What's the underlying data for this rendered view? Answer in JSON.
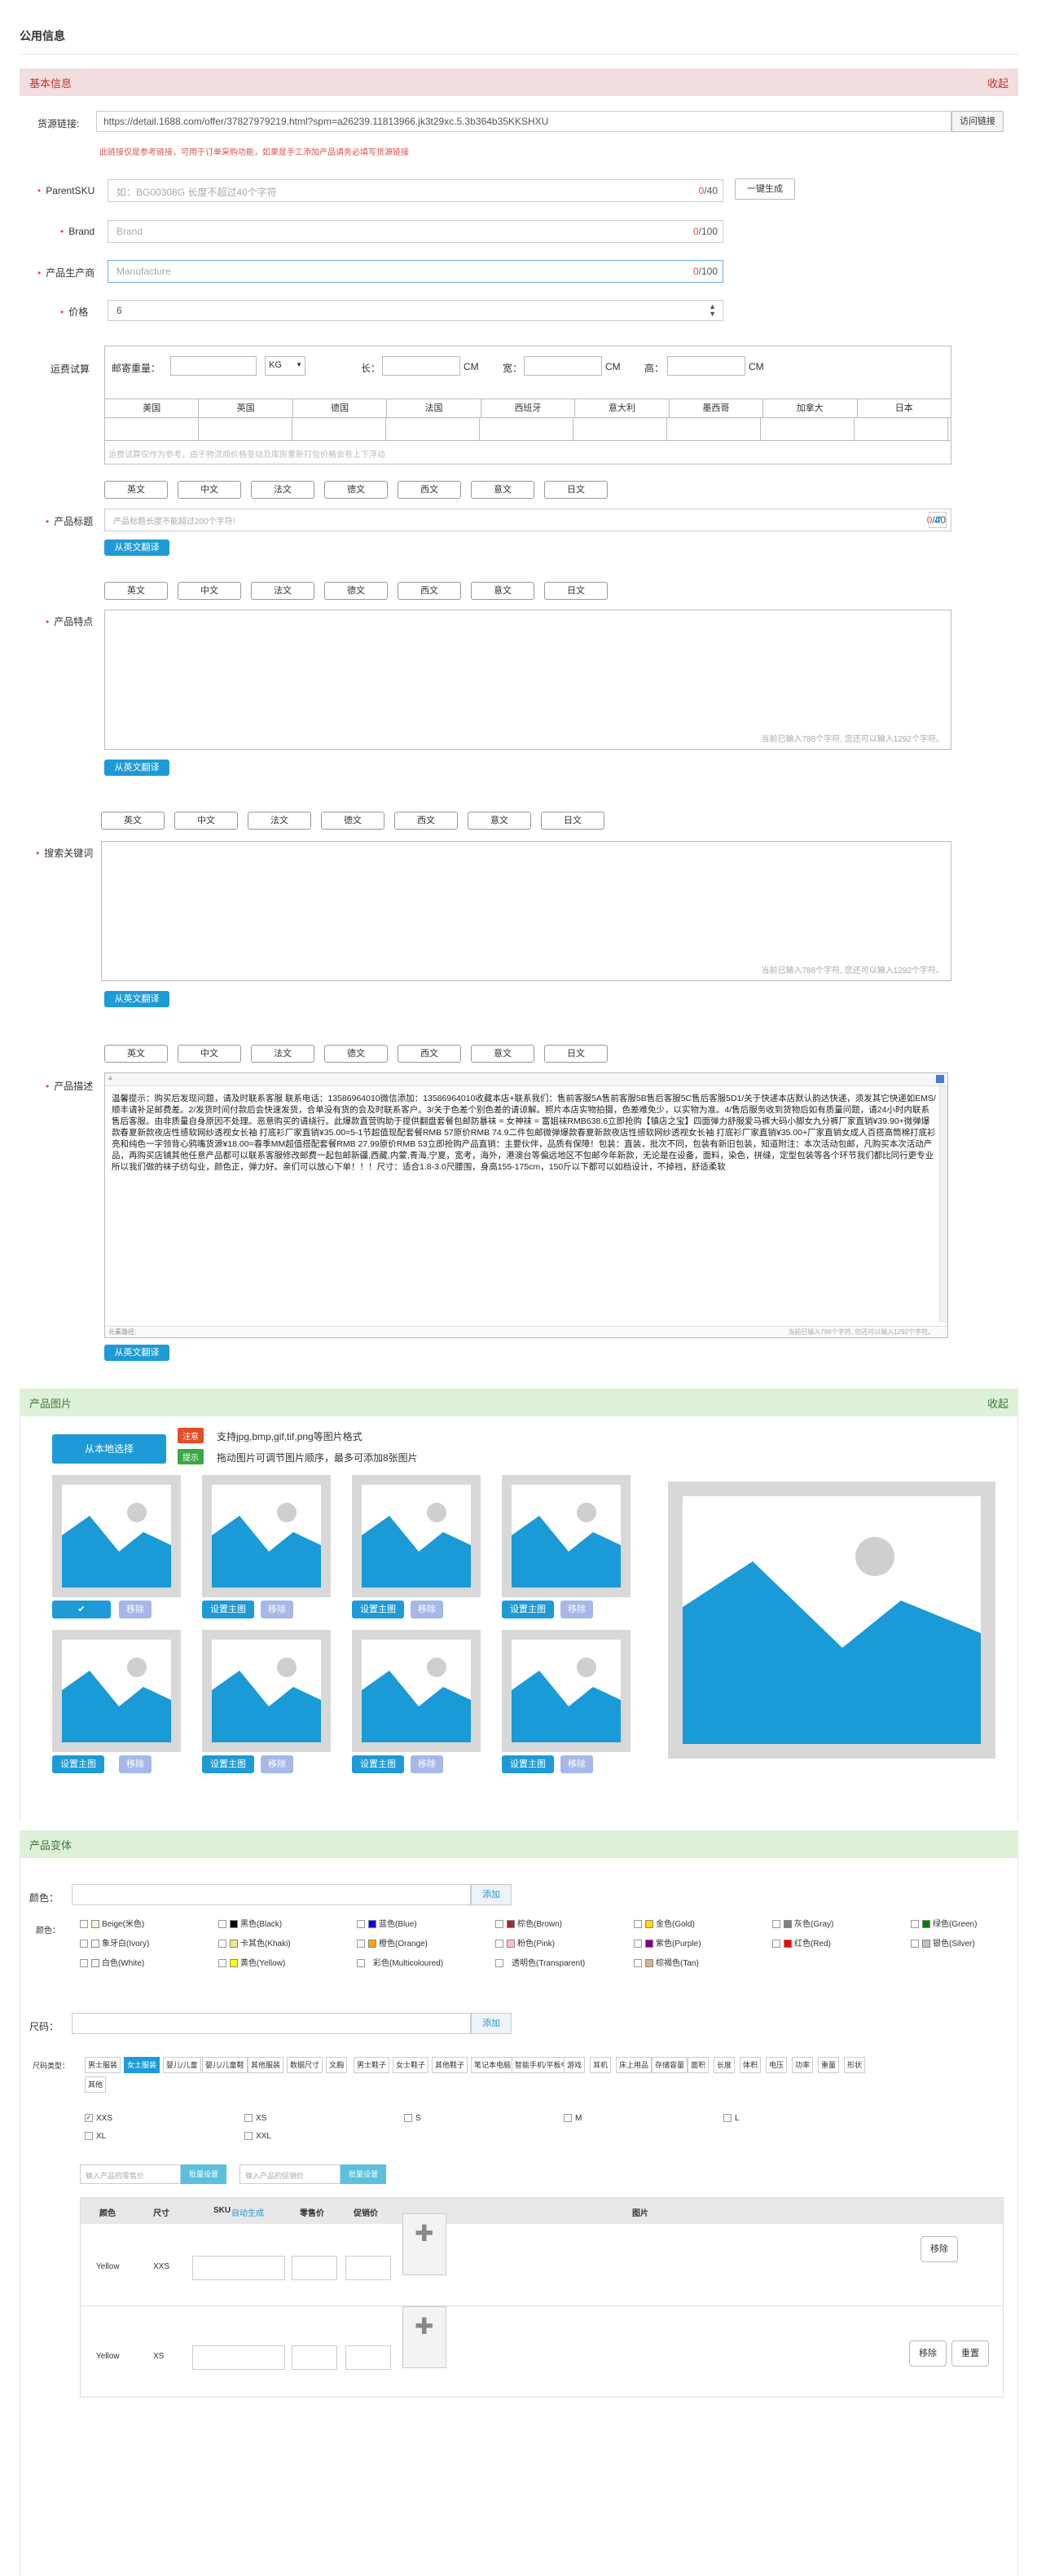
{
  "page_title": "公用信息",
  "basic": {
    "section_title": "基本信息",
    "collapse": "收起",
    "source_label": "货源链接:",
    "source_value": "https://detail.1688.com/offer/37827979219.html?spm=a26239.11813966.jk3t29xc.5.3b364b35KKSHXU",
    "visit_btn": "访问链接",
    "source_note": "此链接仅是参考链接，可用于订单采购功能，如果是手工添加产品请务必填写货源链接",
    "parentsku_label": "ParentSKU",
    "parentsku_placeholder": "如：BG00308G 长度不超过40个字符",
    "parentsku_count": "0",
    "parentsku_max": "/40",
    "generate_btn": "一键生成",
    "brand_label": "Brand",
    "brand_placeholder": "Brand",
    "brand_count": "0",
    "brand_max": "/100",
    "manufacturer_label": "产品生产商",
    "manufacturer_placeholder": "Manufacture",
    "manufacturer_count": "0",
    "manufacturer_max": "/100",
    "price_label": "价格",
    "price_value": "6",
    "shipping_label": "运费试算",
    "weight_label": "邮寄重量：",
    "weight_unit": "KG",
    "length_label": "长：",
    "width_label": "宽：",
    "height_label": "高：",
    "cm": "CM",
    "countries": [
      "美国",
      "英国",
      "德国",
      "法国",
      "西班牙",
      "意大利",
      "墨西哥",
      "加拿大",
      "日本"
    ],
    "shipping_note": "运费试算仅作为参考，由于物流商价格变动及库房重新打包价格会有上下浮动",
    "lang_buttons": [
      "英文",
      "中文",
      "法文",
      "德文",
      "西文",
      "意文",
      "日文"
    ],
    "title_label": "产品标题",
    "title_placeholder": "产品标题长度不能超过200个字符!",
    "title_count": "0",
    "title_max": "/40",
    "translate_btn": "从英文翻译",
    "features_label": "产品特点",
    "features_hint": "当前已输入788个字符, 您还可以输入1292个字符。",
    "keywords_label": "搜索关键词",
    "keywords_hint": "当前已输入788个字符, 您还可以输入1292个字符。",
    "desc_label": "产品描述",
    "desc_text": "温馨提示：购买后发现问题，请及时联系客服 联系电话：13586964010微信添加：13586964010收藏本店+联系我们：售前客服5A售前客服5B售后客服5C售后客服5D1/关于快递本店默认韵达快递，须发其它快递如EMS/顺丰请补足邮费差。2/发货时间付款后会快速发货，合单没有货的会及时联系客户。3/关于色差个别色差的请谅解。照片本店实物拍摄，色差难免少，以实物为准。4/售后服务收到货物后如有质量问题，请24小时内联系售后客服。由非质量自身原因不处理。恶意购买的请绕行。此爆款直营购助于提供翻盘套餐包邮防暴袜 = 女神袜 = 富姐袜RMB638.6立即抢购【镇店之宝】四面弹力舒服爱马裤大码小脚女九分裤厂家直销¥39.90+微弹爆款春夏新款夜店性感软网纱透视女长袖 打底衫厂家直销¥35.00=5-1节超值现配套餐RMB 57原价RMB 74.9二件包邮微弹爆款春夏新款夜店性感软网纱透视女长袖 打底衫厂家直销¥35.00+厂家直销女成人百搭高筒棉打底衫亮和纯色一字领背心鸦嘴货源¥18.00=春季MM超值搭配套餐RMB 27.99原价RMB 53立即抢购产品直销：主要伙伴，品质有保障！包装：直装，批次不同，包装有新旧包装，知道附注：本次活动包邮，凡购买本次活动产品，再购买店铺其他任意产品都可以联系客服修改邮费一起包邮新疆,西藏,内蒙,青海,宁夏，宽考，海外，港澳台等偏远地区不包邮今年新款，无论是在设备，面料，染色，拼缝，定型包装等各个环节我们都比同行更专业所以我们做的袜子纺勾业，颜色正，弹力好。亲们可以放心下单！！！尺寸：适合1.8-3.0尺腰围，身高155-175cm，150斤以下都可以如档设计，不掉裆，舒适柔软",
    "desc_footer_left": "元素路径:",
    "desc_footer_right": "当前已输入788个字符, 您还可以输入1292个字符。"
  },
  "images": {
    "section_title": "产品图片",
    "collapse": "收起",
    "upload_btn": "从本地选择",
    "tag_note": "注意",
    "note_text": "支持jpg,bmp,gif,tif,png等图片格式",
    "tag_tip": "提示",
    "tip_text": "拖动图片可调节图片顺序，最多可添加8张图片",
    "set_main": "设置主图",
    "remove": "移除",
    "check_icon": "check-icon"
  },
  "variants": {
    "section_title": "产品变体",
    "color_label": "颜色：",
    "add": "添加",
    "colors_label": "颜色：",
    "colors": [
      {
        "name": "Beige(米色)",
        "hex": "#f5f5dc"
      },
      {
        "name": "黑色(Black)",
        "hex": "#000000"
      },
      {
        "name": "蓝色(Blue)",
        "hex": "#0000ff"
      },
      {
        "name": "棕色(Brown)",
        "hex": "#a52a2a"
      },
      {
        "name": "金色(Gold)",
        "hex": "#ffd700"
      },
      {
        "name": "灰色(Gray)",
        "hex": "#808080"
      },
      {
        "name": "绿色(Green)",
        "hex": "#008000"
      },
      {
        "name": "象牙白(Ivory)",
        "hex": "#fffff0"
      },
      {
        "name": "卡其色(Khaki)",
        "hex": "#f0e68c"
      },
      {
        "name": "橙色(Orange)",
        "hex": "#ffa500"
      },
      {
        "name": "粉色(Pink)",
        "hex": "#ffc0cb"
      },
      {
        "name": "紫色(Purple)",
        "hex": "#800080"
      },
      {
        "name": "红色(Red)",
        "hex": "#ff0000"
      },
      {
        "name": "银色(Silver)",
        "hex": "#c0c0c0"
      },
      {
        "name": "白色(White)",
        "hex": "#ffffff"
      },
      {
        "name": "黄色(Yellow)",
        "hex": "#ffff00"
      },
      {
        "name": "彩色(Multicoloured)",
        "hex": ""
      },
      {
        "name": "透明色(Transparent)",
        "hex": ""
      },
      {
        "name": "棕褐色(Tan)",
        "hex": "#d2b48c"
      }
    ],
    "size_label": "尺码：",
    "size_type_label": "尺码类型：",
    "size_types": [
      "男士服装",
      "女士服装",
      "婴儿/儿童",
      "婴儿/儿童鞋",
      "其他服装",
      "数据尺寸",
      "文胸",
      "男士鞋子",
      "女士鞋子",
      "其他鞋子",
      "笔记本电脑",
      "智能手机/平板电脑",
      "游戏",
      "耳机",
      "床上用品",
      "存储容量",
      "面积",
      "长度",
      "体积",
      "电压",
      "功率",
      "重量",
      "形状",
      "其他"
    ],
    "sizes": [
      "XXS",
      "XS",
      "S",
      "M",
      "L",
      "XL",
      "XXL"
    ],
    "retail_placeholder": "输入产品的零售价",
    "batch_set": "批量设置",
    "stock_placeholder": "输入产品的促销价",
    "table_headers": [
      "颜色",
      "尺寸",
      "SKU",
      "零售价",
      "促销价",
      "图片"
    ],
    "auto_generate": "自动生成",
    "rows": [
      {
        "color": "Yellow",
        "size": "XXS"
      },
      {
        "color": "Yellow",
        "size": "XS"
      }
    ],
    "row_remove": "移除",
    "row_reset": "重置"
  }
}
